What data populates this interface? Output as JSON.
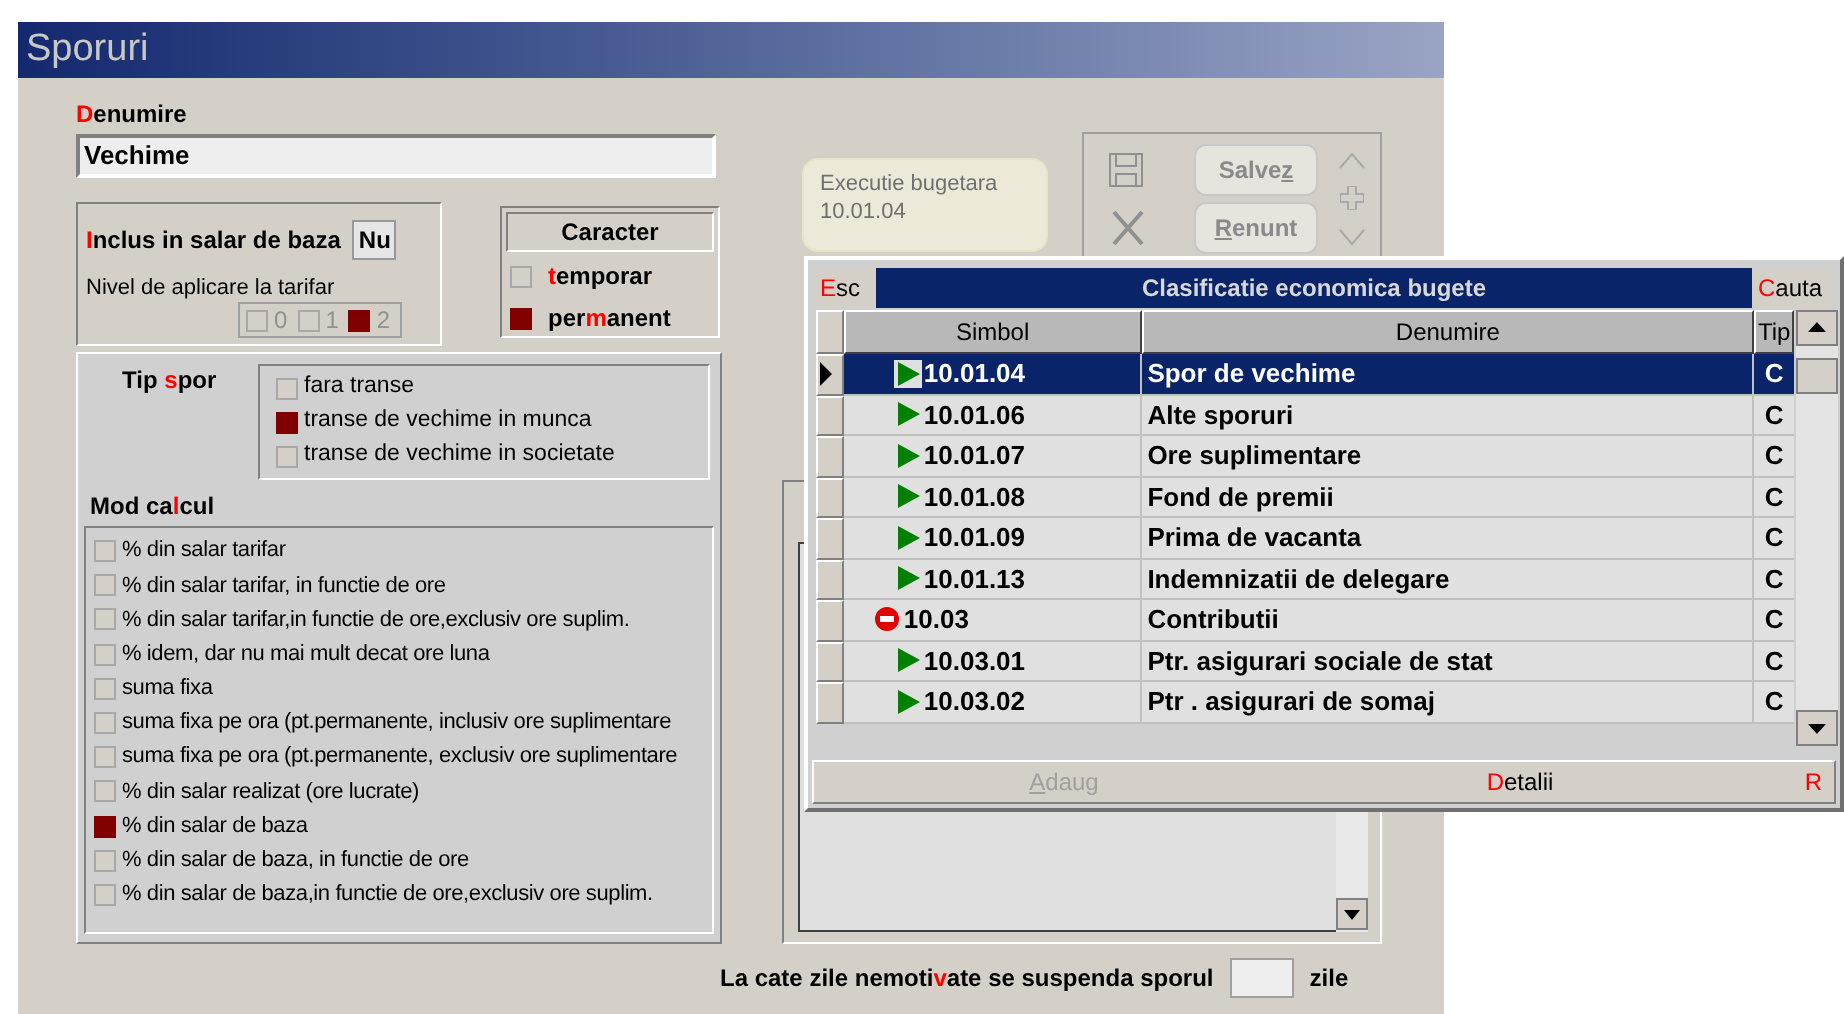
{
  "window": {
    "title": "Sporuri"
  },
  "denumire": {
    "label": {
      "key": "D",
      "after": "enumire"
    },
    "value": "Vechime"
  },
  "inclus": {
    "label": {
      "key": "I",
      "after": "nclus in salar de baza"
    },
    "value": "Nu",
    "nivel_label": "Nivel de aplicare la tarifar",
    "nivel_options": [
      {
        "label": "0",
        "selected": false
      },
      {
        "label": "1",
        "selected": false
      },
      {
        "label": "2",
        "selected": true
      }
    ]
  },
  "caracter": {
    "title": "Caracter",
    "options": [
      {
        "label": {
          "key": "t",
          "after": "emporar"
        },
        "selected": false
      },
      {
        "label": {
          "before": "per",
          "key": "m",
          "after": "anent"
        },
        "selected": true
      }
    ]
  },
  "tip_spor": {
    "label": {
      "before": "Tip ",
      "key": "s",
      "after": "por"
    },
    "options": [
      {
        "label": "fara transe",
        "selected": false
      },
      {
        "label": "transe de vechime in munca",
        "selected": true
      },
      {
        "label": "transe de vechime in societate",
        "selected": false
      }
    ]
  },
  "mod_calcul": {
    "label": {
      "before": "Mod ca",
      "key": "l",
      "after": "cul"
    },
    "options": [
      {
        "label": "% din salar tarifar",
        "selected": false
      },
      {
        "label": "% din salar tarifar, in functie de ore",
        "selected": false
      },
      {
        "label": "% din salar tarifar,in functie de ore,exclusiv ore suplim.",
        "selected": false
      },
      {
        "label": "% idem, dar nu mai mult decat ore luna",
        "selected": false
      },
      {
        "label": "suma fixa",
        "selected": false
      },
      {
        "label": "suma fixa pe ora (pt.permanente, inclusiv ore suplimentare",
        "selected": false
      },
      {
        "label": "suma fixa pe ora (pt.permanente, exclusiv ore suplimentare",
        "selected": false
      },
      {
        "label": "% din salar realizat (ore lucrate)",
        "selected": false
      },
      {
        "label": "% din salar de baza",
        "selected": true
      },
      {
        "label": "% din salar de baza, in functie de ore",
        "selected": false
      },
      {
        "label": "% din salar de baza,in functie de ore,exclusiv ore suplim.",
        "selected": false
      }
    ]
  },
  "executie": {
    "title": "Executie bugetara",
    "code": "10.01.04"
  },
  "toolbar": {
    "buttons": [
      {
        "label": {
          "before": "Salve",
          "key": "z"
        },
        "kind": "save"
      },
      {
        "label": {
          "key": "R",
          "after": "enunt"
        },
        "kind": "cancel"
      }
    ]
  },
  "suspend": {
    "label": {
      "before": "La cate zile nemoti",
      "key": "v",
      "after": "ate se suspenda sporul"
    },
    "unit": "zile"
  },
  "popup": {
    "esc": {
      "key": "E",
      "after": "sc"
    },
    "title": "Clasificatie economica bugete",
    "search": {
      "key": "C",
      "after": "auta"
    },
    "columns": [
      "Simbol",
      "Denumire",
      "Tip"
    ],
    "rows": [
      {
        "symbol": "10.01.04",
        "name": "Spor de vechime",
        "type": "C",
        "kind": "leaf",
        "selected": true
      },
      {
        "symbol": "10.01.06",
        "name": "Alte sporuri",
        "type": "C",
        "kind": "leaf",
        "selected": false
      },
      {
        "symbol": "10.01.07",
        "name": "Ore suplimentare",
        "type": "C",
        "kind": "leaf",
        "selected": false
      },
      {
        "symbol": "10.01.08",
        "name": "Fond de premii",
        "type": "C",
        "kind": "leaf",
        "selected": false
      },
      {
        "symbol": "10.01.09",
        "name": "Prima de vacanta",
        "type": "C",
        "kind": "leaf",
        "selected": false
      },
      {
        "symbol": "10.01.13",
        "name": "Indemnizatii de delegare",
        "type": "C",
        "kind": "leaf",
        "selected": false
      },
      {
        "symbol": "10.03",
        "name": "Contributii",
        "type": "C",
        "kind": "group",
        "selected": false
      },
      {
        "symbol": "10.03.01",
        "name": "Ptr. asigurari sociale de stat",
        "type": "C",
        "kind": "leaf",
        "selected": false
      },
      {
        "symbol": "10.03.02",
        "name": "Ptr . asigurari de somaj",
        "type": "C",
        "kind": "leaf",
        "selected": false
      }
    ],
    "footer": {
      "add": {
        "label": {
          "key": "A",
          "after": "daug"
        },
        "disabled": true
      },
      "details": {
        "label": {
          "key": "D",
          "after": "etalii"
        },
        "disabled": false
      },
      "shortcut": "R"
    }
  }
}
